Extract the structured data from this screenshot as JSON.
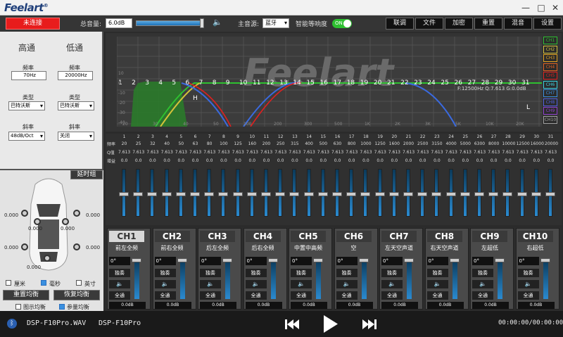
{
  "app": {
    "logo": "Feelart",
    "logo_sup": "®",
    "minimize": "—",
    "maximize": "□",
    "close": "✕"
  },
  "toolbar": {
    "connect": "未连接",
    "total_volume_label": "总音量:",
    "total_volume": "6.0dB",
    "volume_level": 0.93,
    "source_label": "主音源:",
    "source": "蓝牙",
    "smart_loudness_label": "智能等响度",
    "toggle": "ON",
    "buttons": [
      "联调",
      "文件",
      "加密",
      "重置",
      "混音",
      "设置"
    ]
  },
  "crossover": {
    "high_title": "高通",
    "low_title": "低通",
    "freq_label": "频率",
    "high_freq": "70Hz",
    "low_freq": "20000Hz",
    "type_label": "类型",
    "high_type": "巴特沃斯",
    "low_type": "巴特沃斯",
    "slope_label": "斜率",
    "high_slope": "48dB/Oct",
    "low_slope": "关闭"
  },
  "delay": {
    "group_btn": "延时组",
    "values": [
      "0.000",
      "0.000",
      "0.000",
      "0.000",
      "0.000",
      "0.000",
      "0.000"
    ],
    "unit_cm": "厘米",
    "unit_ms": "毫秒",
    "unit_inch": "英寸",
    "reset_eq": "重置均衡",
    "restore_eq": "恢复均衡",
    "graph_eq": "图示均衡",
    "param_eq": "参量均衡"
  },
  "graph": {
    "freq_readout": "F:12500Hz Q:7.613 G:0.0dB",
    "h_label": "H",
    "l_label": "L",
    "watermark": "Feelart",
    "y_ticks": [
      "10",
      "0",
      "-10",
      "-20",
      "-30",
      "-40",
      "-50"
    ],
    "x_ticks": [
      "20",
      "30",
      "40",
      "50",
      "100",
      "200",
      "300",
      "500",
      "1K",
      "2K",
      "3K",
      "5K",
      "10K",
      "20K"
    ],
    "band_markers": [
      "1",
      "2",
      "3",
      "4",
      "5",
      "6",
      "7",
      "8",
      "9",
      "10",
      "11",
      "12",
      "13",
      "14",
      "15",
      "16",
      "17",
      "18",
      "19",
      "20",
      "21",
      "22",
      "23",
      "24",
      "25",
      "26",
      "27",
      "28",
      "29",
      "30",
      "31"
    ]
  },
  "legend": [
    "CH1",
    "CH2",
    "CH3",
    "CH4",
    "CH5",
    "CH6",
    "CH7",
    "CH8",
    "CH9",
    "CH10"
  ],
  "legend_colors": [
    "#2ec030",
    "#d4c23a",
    "#e0a020",
    "#e06020",
    "#e02020",
    "#3ad0e0",
    "#3a90e0",
    "#5060e0",
    "#9040d0",
    "#a0a0a0"
  ],
  "bands": {
    "freq_label": "频率",
    "q_label": "Q值",
    "gain_label": "增益",
    "numbers": [
      "1",
      "2",
      "3",
      "4",
      "5",
      "6",
      "7",
      "8",
      "9",
      "10",
      "11",
      "12",
      "13",
      "14",
      "15",
      "16",
      "17",
      "18",
      "19",
      "20",
      "21",
      "22",
      "23",
      "24",
      "25",
      "26",
      "27",
      "28",
      "29",
      "30",
      "31"
    ],
    "freqs": [
      "20",
      "25",
      "32",
      "40",
      "50",
      "63",
      "80",
      "100",
      "125",
      "160",
      "200",
      "250",
      "315",
      "400",
      "500",
      "630",
      "800",
      "1000",
      "1250",
      "1600",
      "2000",
      "2500",
      "3150",
      "4000",
      "5000",
      "6300",
      "8000",
      "10000",
      "12500",
      "16000",
      "20000"
    ],
    "q": "7.613",
    "gain": "0.0"
  },
  "channels": [
    {
      "name": "CH1",
      "pos": "前左全频"
    },
    {
      "name": "CH2",
      "pos": "前右全频"
    },
    {
      "name": "CH3",
      "pos": "后左全频"
    },
    {
      "name": "CH4",
      "pos": "后右全频"
    },
    {
      "name": "CH5",
      "pos": "中置中高频"
    },
    {
      "name": "CH6",
      "pos": "空"
    },
    {
      "name": "CH7",
      "pos": "左天空声道"
    },
    {
      "name": "CH8",
      "pos": "右天空声道"
    },
    {
      "name": "CH9",
      "pos": "左超低"
    },
    {
      "name": "CH10",
      "pos": "右超低"
    }
  ],
  "channel_ctrl": {
    "phase": "0°",
    "solo": "独奏",
    "speaker": "🔈",
    "pass": "全通",
    "db": "0.0dB"
  },
  "player": {
    "file1": "DSP-F10Pro.WAV",
    "file2": "DSP-F10Pro",
    "time": "00:00:00/00:00:00"
  }
}
